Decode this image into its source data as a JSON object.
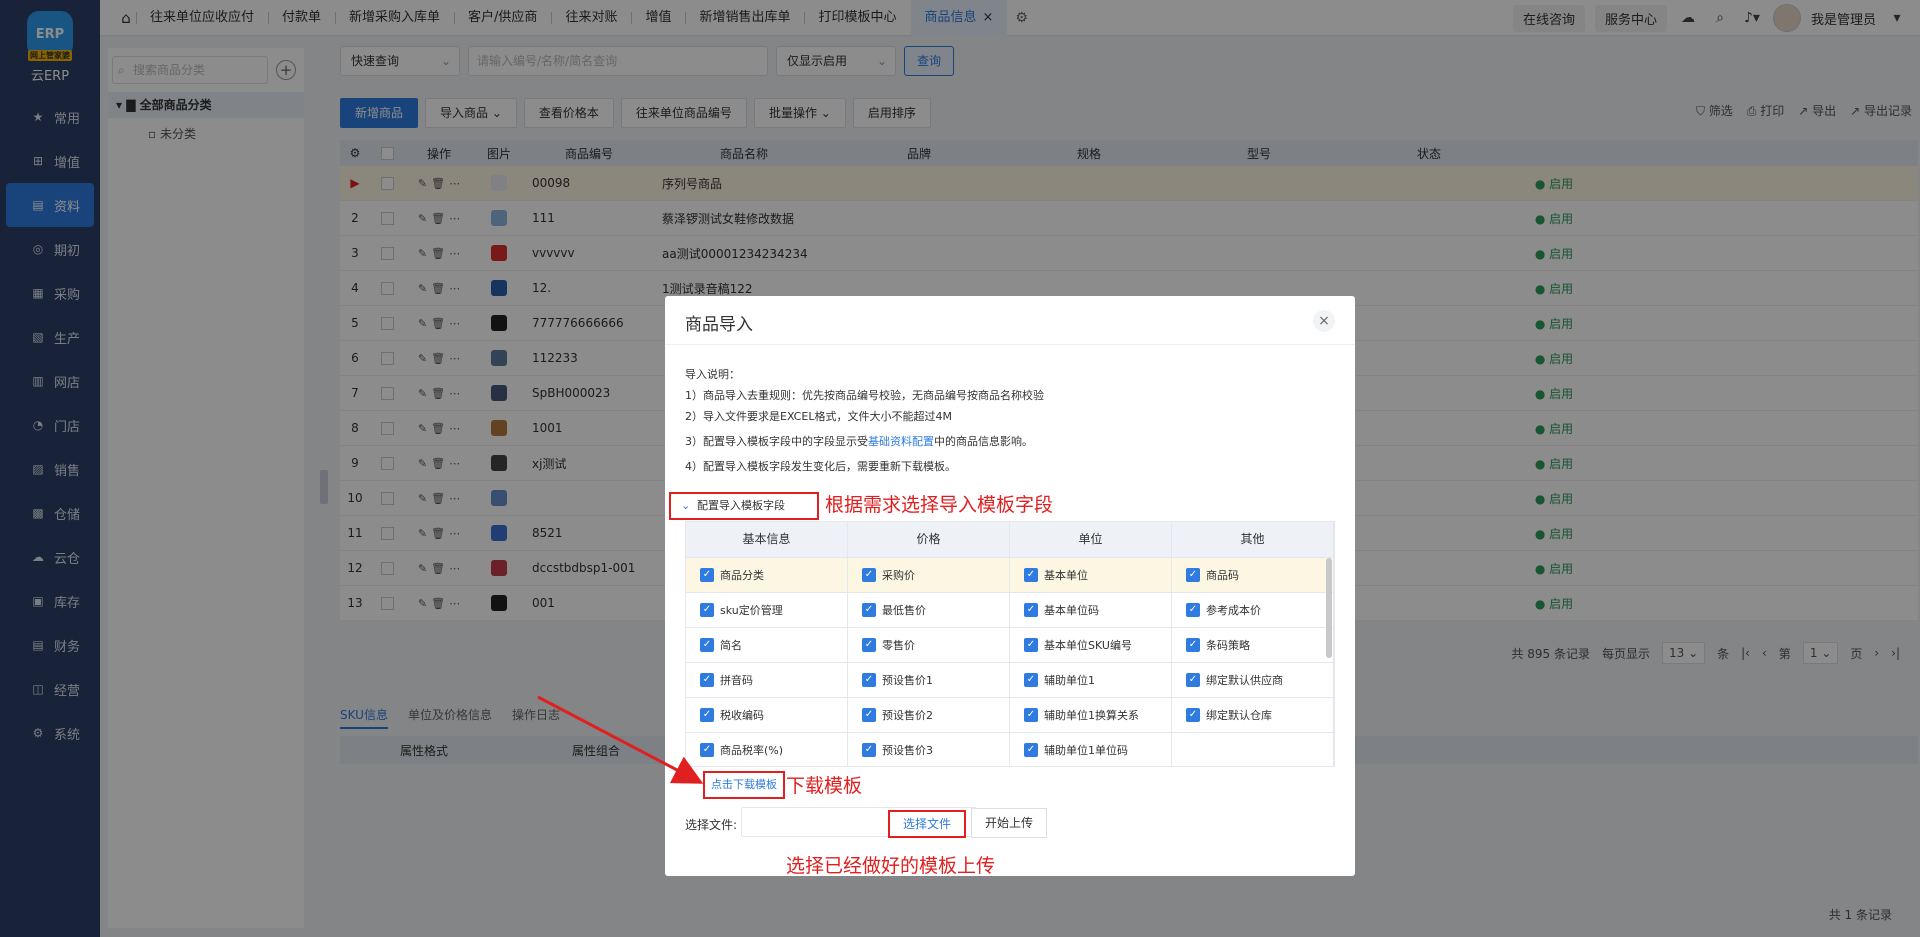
{
  "app": {
    "logo_text": "ERP",
    "logo_badge": "网上管家婆",
    "name": "云ERP"
  },
  "nav": [
    {
      "label": "常用",
      "icon": "star-icon"
    },
    {
      "label": "增值",
      "icon": "plus-square-icon"
    },
    {
      "label": "资料",
      "icon": "document-icon",
      "active": true
    },
    {
      "label": "期初",
      "icon": "target-icon"
    },
    {
      "label": "采购",
      "icon": "purchase-icon"
    },
    {
      "label": "生产",
      "icon": "production-icon"
    },
    {
      "label": "网店",
      "icon": "shop-icon"
    },
    {
      "label": "门店",
      "icon": "store-icon"
    },
    {
      "label": "销售",
      "icon": "sales-icon"
    },
    {
      "label": "仓储",
      "icon": "warehouse-icon"
    },
    {
      "label": "云仓",
      "icon": "cloud-warehouse-icon"
    },
    {
      "label": "库存",
      "icon": "inventory-icon"
    },
    {
      "label": "财务",
      "icon": "finance-icon"
    },
    {
      "label": "经营",
      "icon": "business-icon"
    },
    {
      "label": "系统",
      "icon": "gear-icon"
    }
  ],
  "tabs": [
    "往来单位应收应付",
    "付款单",
    "新增采购入库单",
    "客户/供应商",
    "往来对账",
    "增值",
    "新增销售出库单",
    "打印模板中心",
    "商品信息"
  ],
  "active_tab": "商品信息",
  "topright": {
    "consult": "在线咨询",
    "service": "服务中心",
    "user": "我是管理员"
  },
  "tree": {
    "search_placeholder": "搜索商品分类",
    "root": "全部商品分类",
    "child": "未分类"
  },
  "query": {
    "mode": "快速查询",
    "placeholder": "请输入编号/名称/简名查询",
    "status": "仅显示启用",
    "search_btn": "查询"
  },
  "actions": [
    "新增商品",
    "导入商品",
    "查看价格本",
    "往来单位商品编号",
    "批量操作",
    "启用排序"
  ],
  "right_actions": [
    "筛选",
    "打印",
    "导出",
    "导出记录"
  ],
  "table": {
    "headers": [
      "操作",
      "图片",
      "商品编号",
      "商品名称",
      "品牌",
      "规格",
      "型号",
      "状态"
    ],
    "rows": [
      {
        "no": "▶",
        "code": "00098",
        "name": "序列号商品",
        "status": "启用"
      },
      {
        "no": "2",
        "code": "111",
        "name": "蔡泽锣测试女鞋修改数据",
        "status": "启用"
      },
      {
        "no": "3",
        "code": "vvvvvv",
        "name": "aa测试00001234234234",
        "status": "启用"
      },
      {
        "no": "4",
        "code": "12.",
        "name": "1测试录音稿122",
        "status": "启用"
      },
      {
        "no": "5",
        "code": "777776666666",
        "name": "",
        "status": "启用"
      },
      {
        "no": "6",
        "code": "112233",
        "name": "",
        "status": "启用"
      },
      {
        "no": "7",
        "code": "SpBH000023",
        "name": "",
        "status": "启用"
      },
      {
        "no": "8",
        "code": "1001",
        "name": "",
        "status": "启用"
      },
      {
        "no": "9",
        "code": "xj测试",
        "name": "",
        "status": "启用"
      },
      {
        "no": "10",
        "code": "",
        "name": "",
        "status": "启用"
      },
      {
        "no": "11",
        "code": "8521",
        "name": "",
        "status": "启用"
      },
      {
        "no": "12",
        "code": "dccstbdbsp1-001",
        "name": "",
        "status": "启用"
      },
      {
        "no": "13",
        "code": "001",
        "name": "",
        "status": "启用"
      }
    ]
  },
  "pager": {
    "total": "共 895 条记录",
    "per_page_label": "每页显示",
    "per_page": "13",
    "unit": "条",
    "page_prefix": "第",
    "page": "1",
    "page_suffix": "页"
  },
  "lower_tabs": [
    "SKU信息",
    "单位及价格信息",
    "操作日志"
  ],
  "lower_headers": [
    "属性格式",
    "属性组合"
  ],
  "footer_count": "共 1 条记录",
  "modal": {
    "title": "商品导入",
    "notes_title": "导入说明：",
    "notes": [
      "1）商品导入去重规则：优先按商品编号校验，无商品编号按商品名称校验",
      "2）导入文件要求是EXCEL格式，文件大小不能超过4M",
      "3）配置导入模板字段中的字段显示受",
      "基础资料配置",
      "中的商品信息影响。",
      "4）配置导入模板字段发生变化后，需要重新下载模板。"
    ],
    "config_label": "配置导入模板字段",
    "columns": [
      "基本信息",
      "价格",
      "单位",
      "其他"
    ],
    "rows": [
      [
        "商品分类",
        "采购价",
        "基本单位",
        "商品码"
      ],
      [
        "sku定价管理",
        "最低售价",
        "基本单位码",
        "参考成本价"
      ],
      [
        "简名",
        "零售价",
        "基本单位SKU编号",
        "条码策略"
      ],
      [
        "拼音码",
        "预设售价1",
        "辅助单位1",
        "绑定默认供应商"
      ],
      [
        "税收编码",
        "预设售价2",
        "辅助单位1换算关系",
        "绑定默认仓库"
      ],
      [
        "商品税率(%)",
        "预设售价3",
        "辅助单位1单位码",
        ""
      ]
    ],
    "download_label": "点击下载模板",
    "file_label": "选择文件:",
    "choose_btn": "选择文件",
    "upload_btn": "开始上传"
  },
  "annotations": {
    "config": "根据需求选择导入模板字段",
    "download": "下载模板",
    "upload": "选择已经做好的模板上传",
    "color": "#e02020"
  }
}
